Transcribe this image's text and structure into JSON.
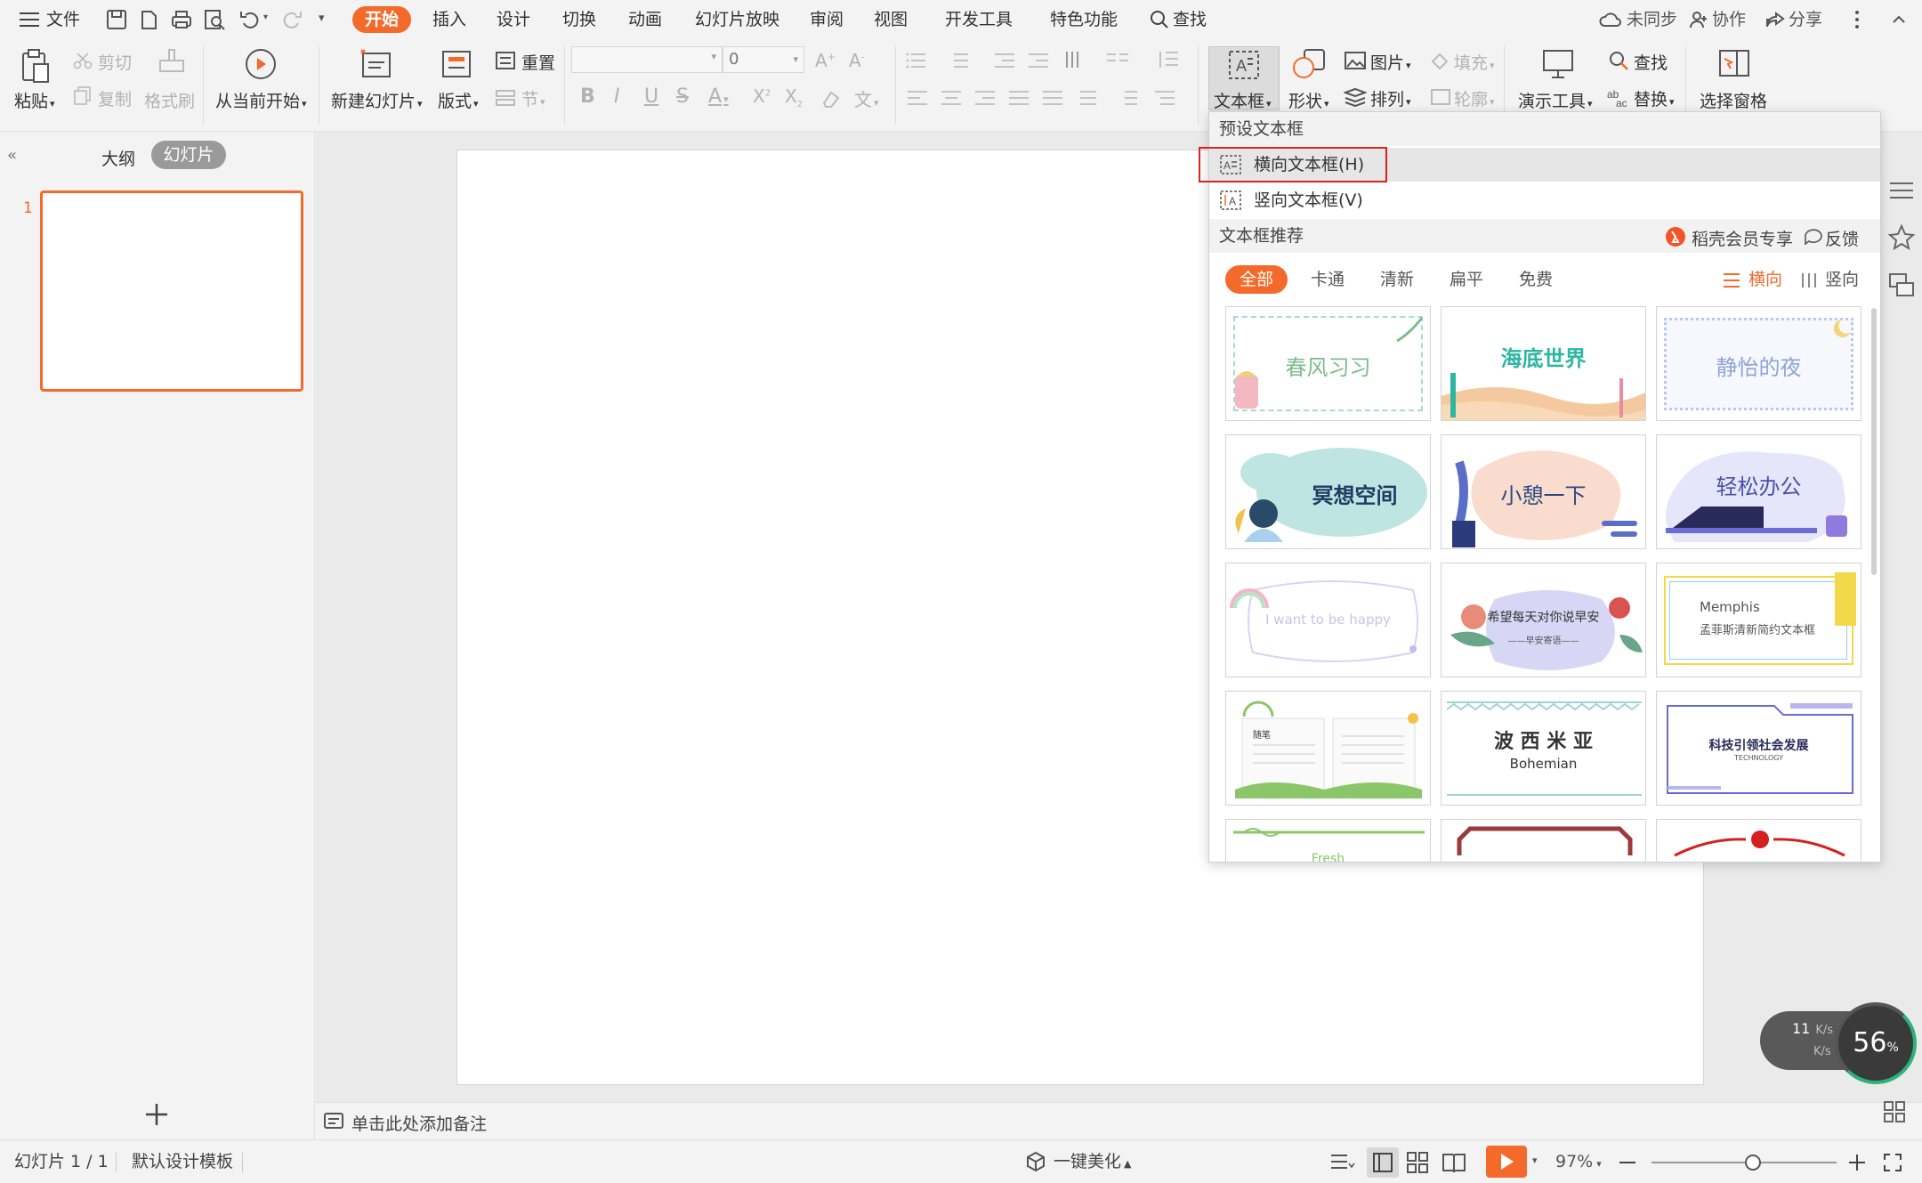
{
  "app": {
    "accent": "#f46a2a"
  },
  "menubar": {
    "file_label": "文件",
    "tabs": [
      "开始",
      "插入",
      "设计",
      "切换",
      "动画",
      "幻灯片放映",
      "审阅",
      "视图",
      "开发工具",
      "特色功能"
    ],
    "search_label": "查找",
    "sync_label": "未同步",
    "collab_label": "协作",
    "share_label": "分享"
  },
  "ribbon": {
    "paste": "粘贴",
    "cut": "剪切",
    "copy": "复制",
    "format_painter": "格式刷",
    "from_current": "从当前开始",
    "new_slide": "新建幻灯片",
    "layout": "版式",
    "reset": "重置",
    "section": "节",
    "font_size": "0",
    "textbox": "文本框",
    "shape": "形状",
    "arrange": "排列",
    "picture": "图片",
    "fill": "填充",
    "outline": "轮廓",
    "present_tools": "演示工具",
    "find": "查找",
    "replace": "替换",
    "selection_pane": "选择窗格"
  },
  "leftpane": {
    "tab_outline": "大纲",
    "tab_slides": "幻灯片",
    "slide_number": "1"
  },
  "notes": {
    "placeholder": "单击此处添加备注"
  },
  "status": {
    "slide_info": "幻灯片 1 / 1",
    "template": "默认设计模板",
    "beautify": "一键美化",
    "zoom": "97%",
    "zoom_fraction": 0.55
  },
  "dropdown": {
    "preset_header": "预设文本框",
    "horizontal": "横向文本框(H)",
    "vertical": "竖向文本框(V)",
    "recommend_header": "文本框推荐",
    "member": "稻壳会员专享",
    "feedback": "反馈",
    "filters": [
      "全部",
      "卡通",
      "清新",
      "扁平",
      "免费"
    ],
    "orient_h": "横向",
    "orient_v": "竖向",
    "cards": [
      {
        "label": "春风习习",
        "color": "#7dbb8c"
      },
      {
        "label": "海底世界",
        "color": "#2fb6a2"
      },
      {
        "label": "静怡的夜",
        "color": "#8da5d8"
      },
      {
        "label": "冥想空间",
        "color": "#1f3b63"
      },
      {
        "label": "小憩一下",
        "color": "#2a4a87"
      },
      {
        "label": "轻松办公",
        "color": "#4a52a8"
      },
      {
        "label": "I  want  to  be  happy",
        "color": "#c9c3e6"
      },
      {
        "label": "希望每天对你说早安",
        "color": "#333333"
      },
      {
        "label": "Memphis",
        "color": "#555555"
      },
      {
        "label": "波 西 米 亚",
        "color": "#333333"
      },
      {
        "label": "科技引领社会发展",
        "color": "#2a2a5a"
      }
    ],
    "card_small": {
      "morning_sub": "——早安寄语——",
      "memphis_sub": "孟菲斯清新简约文本框",
      "bohemian_sub": "Bohemian",
      "tech_sub": "TECHNOLOGY",
      "essay_title": "随笔",
      "fresh": "Fresh"
    }
  },
  "widget": {
    "percent": "56",
    "percent_sign": "%",
    "up_speed": "11",
    "speed_unit": "K/s"
  }
}
